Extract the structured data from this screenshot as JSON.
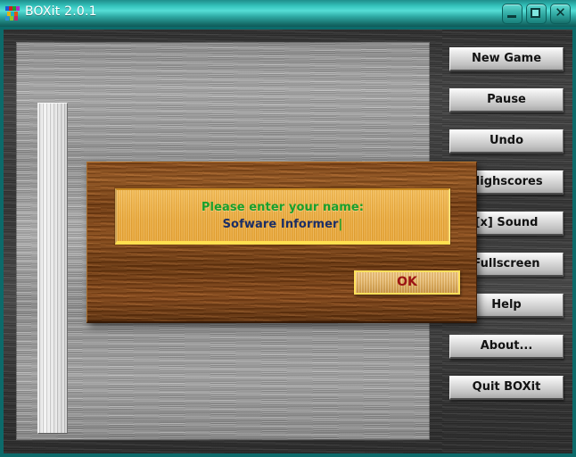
{
  "window": {
    "title": "BOXit 2.0.1",
    "icon": "boxit-app-icon",
    "accent_color": "#2fa8a1",
    "controls": [
      {
        "name": "minimize",
        "glyph": "minimize-icon"
      },
      {
        "name": "maximize",
        "glyph": "maximize-icon"
      },
      {
        "name": "close",
        "glyph": "close-icon",
        "label": "✕"
      }
    ]
  },
  "sidebar": {
    "buttons": [
      {
        "label": "New Game",
        "name": "new-game"
      },
      {
        "label": "Pause",
        "name": "pause"
      },
      {
        "label": "Undo",
        "name": "undo"
      },
      {
        "label": "Highscores",
        "name": "highscores"
      },
      {
        "label": "[x] Sound",
        "name": "sound-toggle"
      },
      {
        "label": "Fullscreen",
        "name": "fullscreen"
      },
      {
        "label": "Help",
        "name": "help"
      },
      {
        "label": "About...",
        "name": "about"
      },
      {
        "label": "Quit BOXit",
        "name": "quit"
      }
    ]
  },
  "playfield": {
    "level_bar_name": "level-progress-bar"
  },
  "dialog": {
    "prompt": "Please enter your name:",
    "value": "Sofware Informer",
    "caret": "|",
    "ok_label": "OK",
    "prompt_color": "#18a02c",
    "value_color": "#1b2e66",
    "ok_color": "#9b1414"
  }
}
